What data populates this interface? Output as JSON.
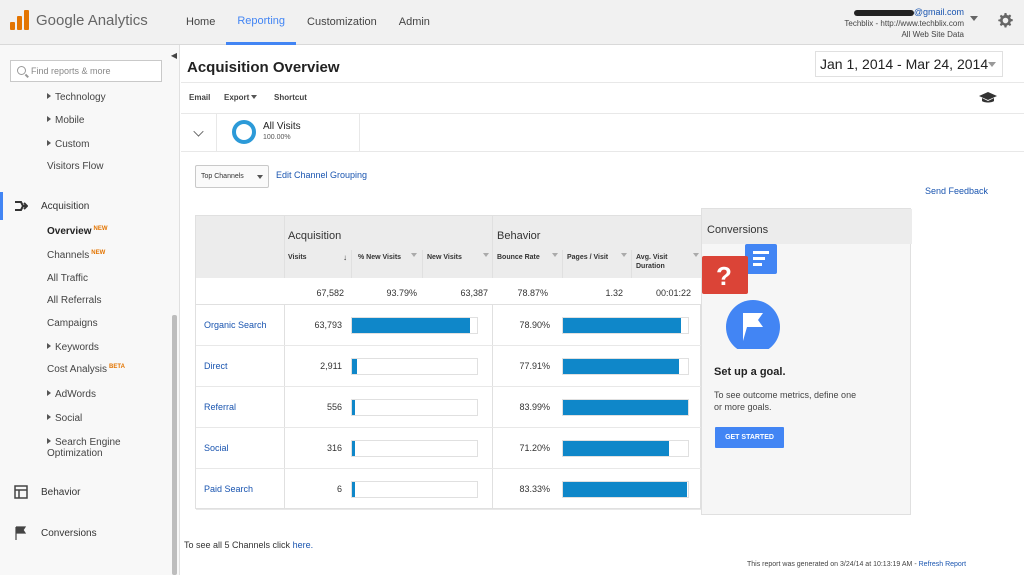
{
  "brand": {
    "logo_text": "Google Analytics",
    "accent": "#e37400"
  },
  "nav": [
    {
      "label": "Home"
    },
    {
      "label": "Reporting"
    },
    {
      "label": "Customization"
    },
    {
      "label": "Admin"
    }
  ],
  "account": {
    "email_suffix": "@gmail.com",
    "property": "Techblix - http://www.techblix.com",
    "view": "All Web Site Data"
  },
  "search": {
    "placeholder": "Find reports & more"
  },
  "sidebar": {
    "items": [
      {
        "label": "Technology"
      },
      {
        "label": "Mobile"
      },
      {
        "label": "Custom"
      },
      {
        "label": "Visitors Flow"
      }
    ],
    "acquisition": {
      "label": "Acquisition",
      "sub": [
        {
          "label": "Overview",
          "badge": "NEW"
        },
        {
          "label": "Channels",
          "badge": "NEW"
        },
        {
          "label": "All Traffic"
        },
        {
          "label": "All Referrals"
        },
        {
          "label": "Campaigns"
        },
        {
          "label": "Keywords"
        },
        {
          "label": "Cost Analysis",
          "badge": "BETA"
        },
        {
          "label": "AdWords"
        },
        {
          "label": "Social"
        },
        {
          "label": "Search Engine Optimization"
        }
      ]
    },
    "behavior": {
      "label": "Behavior"
    },
    "conversions": {
      "label": "Conversions"
    }
  },
  "page": {
    "title": "Acquisition Overview",
    "date_range": "Jan 1, 2014 - Mar 24, 2014",
    "toolbar": {
      "email": "Email",
      "export": "Export",
      "shortcut": "Shortcut"
    },
    "segment": {
      "name": "All Visits",
      "pct": "100.00%"
    },
    "channel_dropdown": "Top Channels",
    "edit_grouping": "Edit Channel Grouping",
    "send_feedback": "Send Feedback"
  },
  "table": {
    "groups": {
      "acquisition": "Acquisition",
      "behavior": "Behavior",
      "conversions": "Conversions"
    },
    "columns": {
      "visits": "Visits",
      "new_visits_pct": "% New Visits",
      "new_visits": "New Visits",
      "bounce_rate": "Bounce Rate",
      "pages_visit": "Pages / Visit",
      "avg_duration": "Avg. Visit Duration"
    },
    "totals": {
      "visits": "67,582",
      "new_visits_pct": "93.79%",
      "new_visits": "63,387",
      "bounce_rate": "78.87%",
      "pages_visit": "1.32",
      "avg_duration": "00:01:22"
    },
    "rows": [
      {
        "channel": "Organic Search",
        "visits": "63,793",
        "bounce": "78.90%",
        "visits_share": 0.94,
        "bounce_share": 0.94
      },
      {
        "channel": "Direct",
        "visits": "2,911",
        "bounce": "77.91%",
        "visits_share": 0.04,
        "bounce_share": 0.93
      },
      {
        "channel": "Referral",
        "visits": "556",
        "bounce": "83.99%",
        "visits_share": 0.01,
        "bounce_share": 1.0
      },
      {
        "channel": "Social",
        "visits": "316",
        "bounce": "71.20%",
        "visits_share": 0.01,
        "bounce_share": 0.85
      },
      {
        "channel": "Paid Search",
        "visits": "6",
        "bounce": "83.33%",
        "visits_share": 0.005,
        "bounce_share": 0.99
      }
    ],
    "bar_color": "#0f87c9"
  },
  "conversions_panel": {
    "title": "Set up a goal.",
    "desc": "To see outcome metrics, define one or more goals.",
    "button": "GET STARTED"
  },
  "footer": {
    "see_all_prefix": "To see all 5 Channels click",
    "see_all_link": "here.",
    "generated": "This report was generated on 3/24/14 at 10:13:19 AM -",
    "refresh": "Refresh Report"
  }
}
